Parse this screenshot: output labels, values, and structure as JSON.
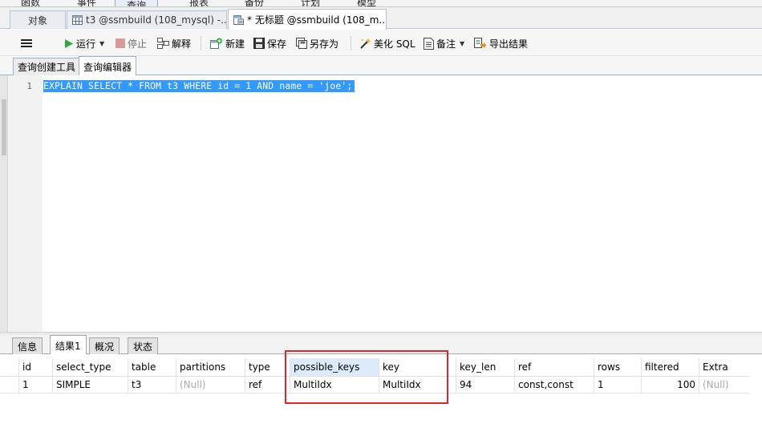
{
  "menu": [
    "函数",
    "事件",
    "查询",
    "报表",
    "备份",
    "计划",
    "模型"
  ],
  "doc_tabs": [
    {
      "label": "对象"
    },
    {
      "label": "t3 @ssmbuild (108_mysql) -..."
    },
    {
      "label": "* 无标题 @ssmbuild (108_m..."
    }
  ],
  "toolbar": {
    "run": "运行",
    "stop": "停止",
    "explain": "解释",
    "new": "新建",
    "save": "保存",
    "save_as": "另存为",
    "beautify": "美化 SQL",
    "note": "备注",
    "export": "导出结果"
  },
  "editor_tabs": [
    "查询创建工具",
    "查询编辑器"
  ],
  "editor": {
    "line_number": "1",
    "code": "EXPLAIN SELECT * FROM t3 WHERE id = 1 AND name = 'joe';"
  },
  "result_tabs": [
    "信息",
    "结果1",
    "概况",
    "状态"
  ],
  "grid": {
    "columns": [
      "id",
      "select_type",
      "table",
      "partitions",
      "type",
      "possible_keys",
      "key",
      "key_len",
      "ref",
      "rows",
      "filtered",
      "Extra"
    ],
    "row": [
      "1",
      "SIMPLE",
      "t3",
      "(Null)",
      "ref",
      "MultiIdx",
      "MultiIdx",
      "94",
      "const,const",
      "1",
      "100",
      "(Null)"
    ]
  },
  "colors": {
    "selection": "#3399ff",
    "annotation": "#e0262d",
    "header_highlight": "#dcebfb"
  }
}
